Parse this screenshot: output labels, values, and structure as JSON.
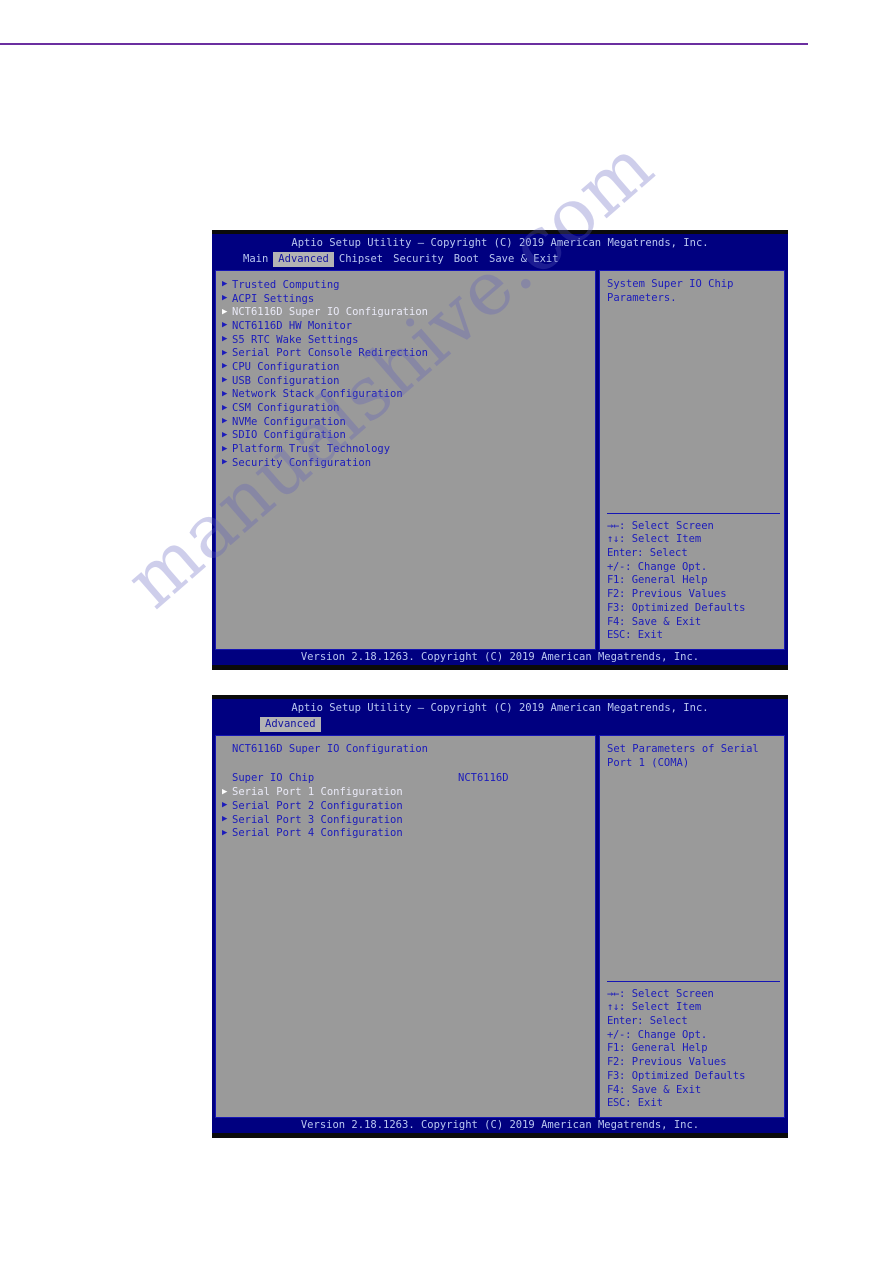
{
  "page": {
    "watermark": "manualshive.com",
    "rule_color": "#6b2fa0"
  },
  "theme": {
    "bios_blue": "#000080",
    "panel_gray": "#9a9a9a",
    "text_blue": "#1b1bbb",
    "title_text": "#b9c6ef",
    "highlight_bg": "#b3b3b3"
  },
  "screen1": {
    "title": "Aptio Setup Utility – Copyright (C) 2019 American Megatrends, Inc.",
    "tabs": [
      {
        "label": "Main",
        "active": false
      },
      {
        "label": "Advanced",
        "active": true
      },
      {
        "label": "Chipset",
        "active": false
      },
      {
        "label": "Security",
        "active": false
      },
      {
        "label": "Boot",
        "active": false
      },
      {
        "label": "Save & Exit",
        "active": false
      }
    ],
    "menu": [
      {
        "label": "Trusted Computing",
        "selected": false
      },
      {
        "label": "ACPI Settings",
        "selected": false
      },
      {
        "label": "NCT6116D Super IO Configuration",
        "selected": true
      },
      {
        "label": "NCT6116D HW Monitor",
        "selected": false
      },
      {
        "label": "S5 RTC Wake Settings",
        "selected": false
      },
      {
        "label": "Serial Port Console Redirection",
        "selected": false
      },
      {
        "label": "CPU Configuration",
        "selected": false
      },
      {
        "label": "USB Configuration",
        "selected": false
      },
      {
        "label": "Network Stack Configuration",
        "selected": false
      },
      {
        "label": "CSM Configuration",
        "selected": false
      },
      {
        "label": "NVMe Configuration",
        "selected": false
      },
      {
        "label": "SDIO Configuration",
        "selected": false
      },
      {
        "label": "Platform Trust Technology",
        "selected": false
      },
      {
        "label": "Security Configuration",
        "selected": false
      }
    ],
    "help": "System Super IO Chip Parameters.",
    "legend": [
      {
        "key": "→←",
        "text": ": Select Screen"
      },
      {
        "key": "↑↓",
        "text": ": Select Item"
      },
      {
        "key": "Enter",
        "text": ": Select"
      },
      {
        "key": "+/-",
        "text": ": Change Opt."
      },
      {
        "key": "F1",
        "text": ": General Help"
      },
      {
        "key": "F2",
        "text": ": Previous Values"
      },
      {
        "key": "F3",
        "text": ": Optimized Defaults"
      },
      {
        "key": "F4",
        "text": ": Save & Exit"
      },
      {
        "key": "ESC",
        "text": ": Exit"
      }
    ],
    "version": "Version 2.18.1263. Copyright (C) 2019 American Megatrends, Inc."
  },
  "screen2": {
    "title": "Aptio Setup Utility – Copyright (C) 2019 American Megatrends, Inc.",
    "tabs": [
      {
        "label": "Advanced",
        "active": true
      }
    ],
    "section_title": "NCT6116D Super IO Configuration",
    "chip_label": "Super IO Chip",
    "chip_value": "NCT6116D",
    "menu": [
      {
        "label": "Serial Port 1 Configuration",
        "selected": true
      },
      {
        "label": "Serial Port 2 Configuration",
        "selected": false
      },
      {
        "label": "Serial Port 3 Configuration",
        "selected": false
      },
      {
        "label": "Serial Port 4 Configuration",
        "selected": false
      }
    ],
    "help": "Set Parameters of Serial Port 1 (COMA)",
    "legend": [
      {
        "key": "→←",
        "text": ": Select Screen"
      },
      {
        "key": "↑↓",
        "text": ": Select Item"
      },
      {
        "key": "Enter",
        "text": ": Select"
      },
      {
        "key": "+/-",
        "text": ": Change Opt."
      },
      {
        "key": "F1",
        "text": ": General Help"
      },
      {
        "key": "F2",
        "text": ": Previous Values"
      },
      {
        "key": "F3",
        "text": ": Optimized Defaults"
      },
      {
        "key": "F4",
        "text": ": Save & Exit"
      },
      {
        "key": "ESC",
        "text": ": Exit"
      }
    ],
    "version": "Version 2.18.1263. Copyright (C) 2019 American Megatrends, Inc."
  }
}
